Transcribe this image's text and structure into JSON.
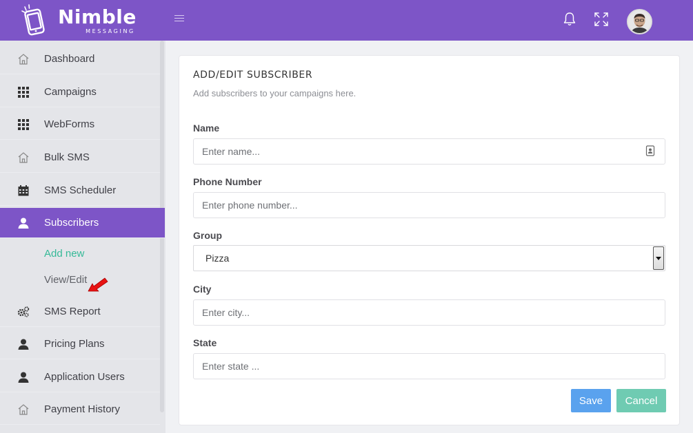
{
  "brand": {
    "name": "Nimble",
    "tagline": "MESSAGING"
  },
  "colors": {
    "primary": "#7d55c7",
    "sidebar_bg": "#e4e5e9",
    "accent_green": "#35b997",
    "save_blue": "#5aa2ee",
    "cancel_green": "#6fcbb2"
  },
  "header_icons": [
    "menu-icon",
    "bell-icon",
    "fullscreen-icon",
    "user-avatar"
  ],
  "sidebar": {
    "items": [
      {
        "label": "Dashboard",
        "icon": "home-icon"
      },
      {
        "label": "Campaigns",
        "icon": "grid-icon"
      },
      {
        "label": "WebForms",
        "icon": "grid-icon"
      },
      {
        "label": "Bulk SMS",
        "icon": "home-icon"
      },
      {
        "label": "SMS Scheduler",
        "icon": "calendar-icon"
      },
      {
        "label": "Subscribers",
        "icon": "user-icon",
        "active": true
      },
      {
        "label": "SMS Report",
        "icon": "gears-icon"
      },
      {
        "label": "Pricing Plans",
        "icon": "user-icon"
      },
      {
        "label": "Application Users",
        "icon": "user-icon"
      },
      {
        "label": "Payment History",
        "icon": "home-icon"
      }
    ],
    "submenu": [
      {
        "label": "Add new",
        "active": true
      },
      {
        "label": "View/Edit"
      }
    ]
  },
  "form": {
    "title": "ADD/EDIT SUBSCRIBER",
    "subtitle": "Add subscribers to your campaigns here.",
    "fields": {
      "name": {
        "label": "Name",
        "placeholder": "Enter name..."
      },
      "phone": {
        "label": "Phone Number",
        "placeholder": "Enter phone number..."
      },
      "group": {
        "label": "Group",
        "value": "Pizza"
      },
      "city": {
        "label": "City",
        "placeholder": "Enter city..."
      },
      "state": {
        "label": "State",
        "placeholder": "Enter state ..."
      }
    },
    "buttons": {
      "save": "Save",
      "cancel": "Cancel"
    }
  }
}
